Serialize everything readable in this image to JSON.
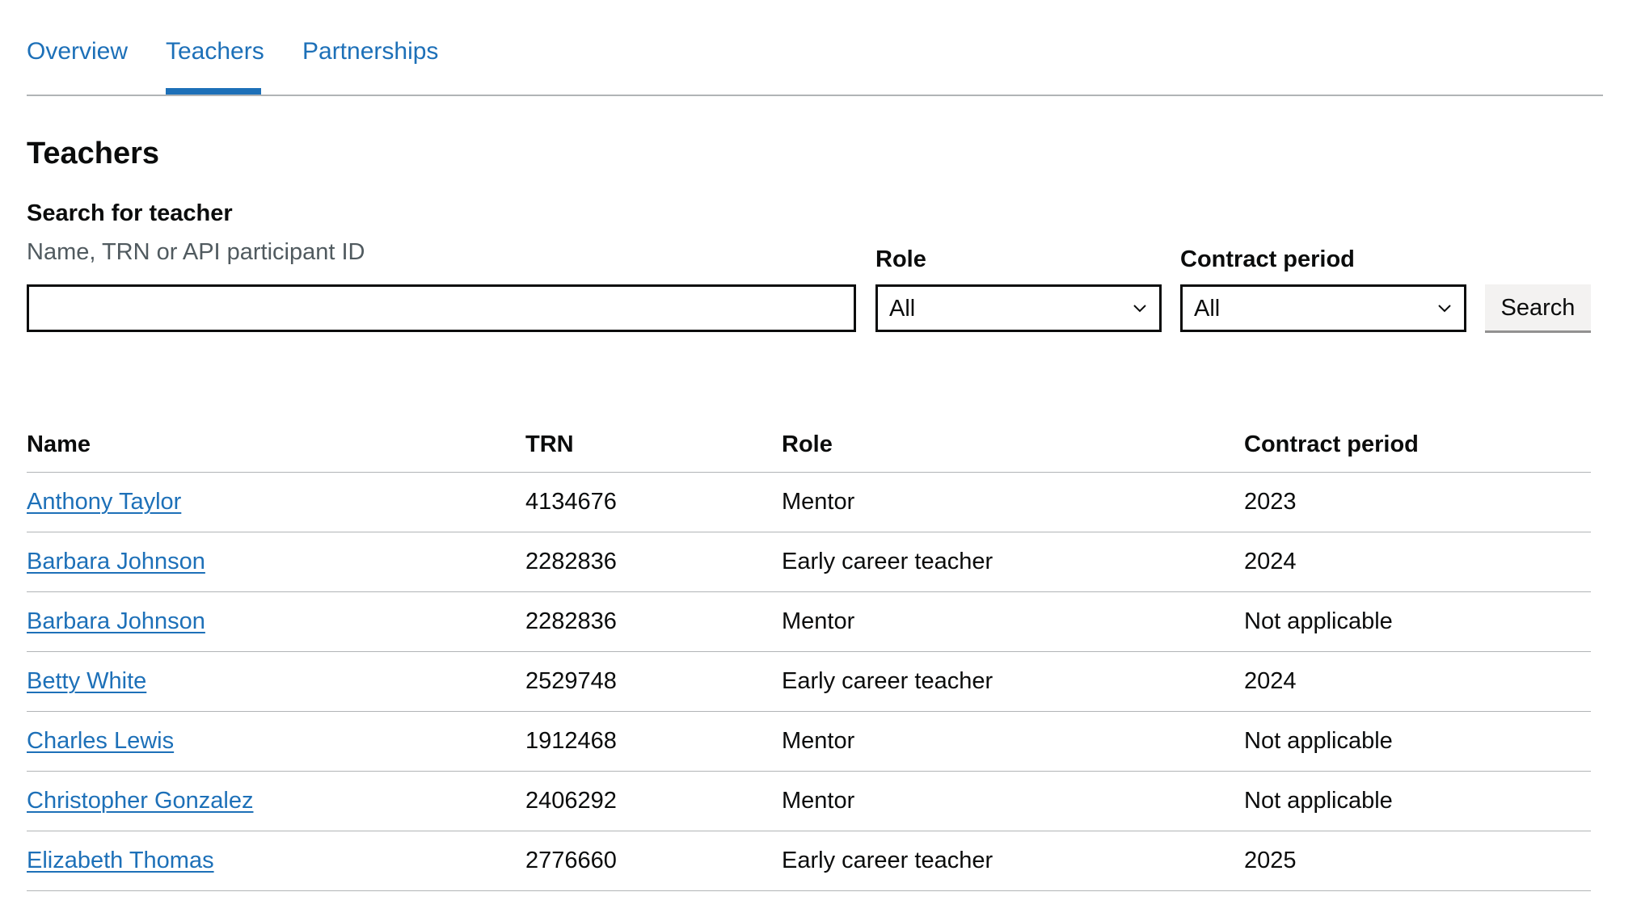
{
  "tabs": [
    {
      "label": "Overview",
      "active": false
    },
    {
      "label": "Teachers",
      "active": true
    },
    {
      "label": "Partnerships",
      "active": false
    }
  ],
  "page_title": "Teachers",
  "search": {
    "label": "Search for teacher",
    "hint": "Name, TRN or API participant ID",
    "value": ""
  },
  "filters": {
    "role": {
      "label": "Role",
      "value": "All",
      "icon": "chevron-down-icon"
    },
    "contract_period": {
      "label": "Contract period",
      "value": "All",
      "icon": "chevron-down-icon"
    }
  },
  "search_button": "Search",
  "colors": {
    "link": "#1d70b8",
    "text": "#0b0c0c",
    "hint": "#505a5f",
    "border": "#b1b4b6",
    "button_bg": "#f3f2f1"
  },
  "table": {
    "headers": [
      "Name",
      "TRN",
      "Role",
      "Contract period"
    ],
    "rows": [
      {
        "name": "Anthony Taylor",
        "trn": "4134676",
        "role": "Mentor",
        "contract_period": "2023"
      },
      {
        "name": "Barbara Johnson",
        "trn": "2282836",
        "role": "Early career teacher",
        "contract_period": "2024"
      },
      {
        "name": "Barbara Johnson",
        "trn": "2282836",
        "role": "Mentor",
        "contract_period": "Not applicable"
      },
      {
        "name": "Betty White",
        "trn": "2529748",
        "role": "Early career teacher",
        "contract_period": "2024"
      },
      {
        "name": "Charles Lewis",
        "trn": "1912468",
        "role": "Mentor",
        "contract_period": "Not applicable"
      },
      {
        "name": "Christopher Gonzalez",
        "trn": "2406292",
        "role": "Mentor",
        "contract_period": "Not applicable"
      },
      {
        "name": "Elizabeth Thomas",
        "trn": "2776660",
        "role": "Early career teacher",
        "contract_period": "2025"
      }
    ]
  }
}
